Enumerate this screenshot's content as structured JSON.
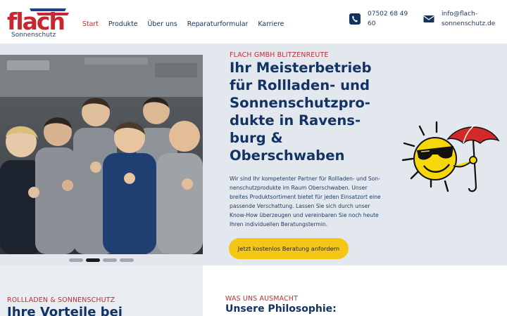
{
  "brand": {
    "logo_text": "flach",
    "logo_subtext": "Sonnenschutz",
    "colors": {
      "primary": "#123363",
      "accent": "#c8272f",
      "cta": "#f6c616",
      "hero_bg": "#e3e8ef"
    }
  },
  "nav": {
    "items": [
      {
        "label": "Start",
        "active": true
      },
      {
        "label": "Produkte",
        "active": false
      },
      {
        "label": "Über uns",
        "active": false
      },
      {
        "label": "Reparaturformular",
        "active": false
      },
      {
        "label": "Karriere",
        "active": false
      }
    ]
  },
  "contact": {
    "phone_line1": "07502 68 49",
    "phone_line2": "60",
    "email_line1": "info@flach-",
    "email_line2": "sonnenschutz.de",
    "phone_icon": "phone-icon",
    "mail_icon": "mail-icon"
  },
  "hero": {
    "eyebrow": "FLACH GMBH BLITZENREUTE",
    "headline_lines": [
      "Ihr Meisterbetrieb",
      "für Rollladen- und",
      "Sonnenschutzpro-",
      "dukte in Ravens-",
      "burg &",
      "Oberschwaben"
    ],
    "lead_lines": [
      "Wir sind Ihr kompetenter Partner für Rollladen- und Son-",
      "nenschutzprodukte im Raum Oberschwaben. Unser",
      "breites Produktsortiment bietet für jeden Einsatzort eine",
      "passende Verschattung. Lassen Sie sich durch unser",
      "Know-How überzeugen und vereinbaren Sie noch heute",
      "Ihren individuellen Beratungstermin."
    ],
    "cta_label": "Jetzt kostenlos Beratung anfordern",
    "slider": {
      "count": 4,
      "active_index": 1
    }
  },
  "sections": {
    "left": {
      "eyebrow": "ROLLLADEN & SONNENSCHUTZ",
      "title": "Ihre Vorteile bei"
    },
    "right": {
      "eyebrow": "WAS UNS AUSMACHT",
      "title": "Unsere Philosophie:"
    }
  }
}
